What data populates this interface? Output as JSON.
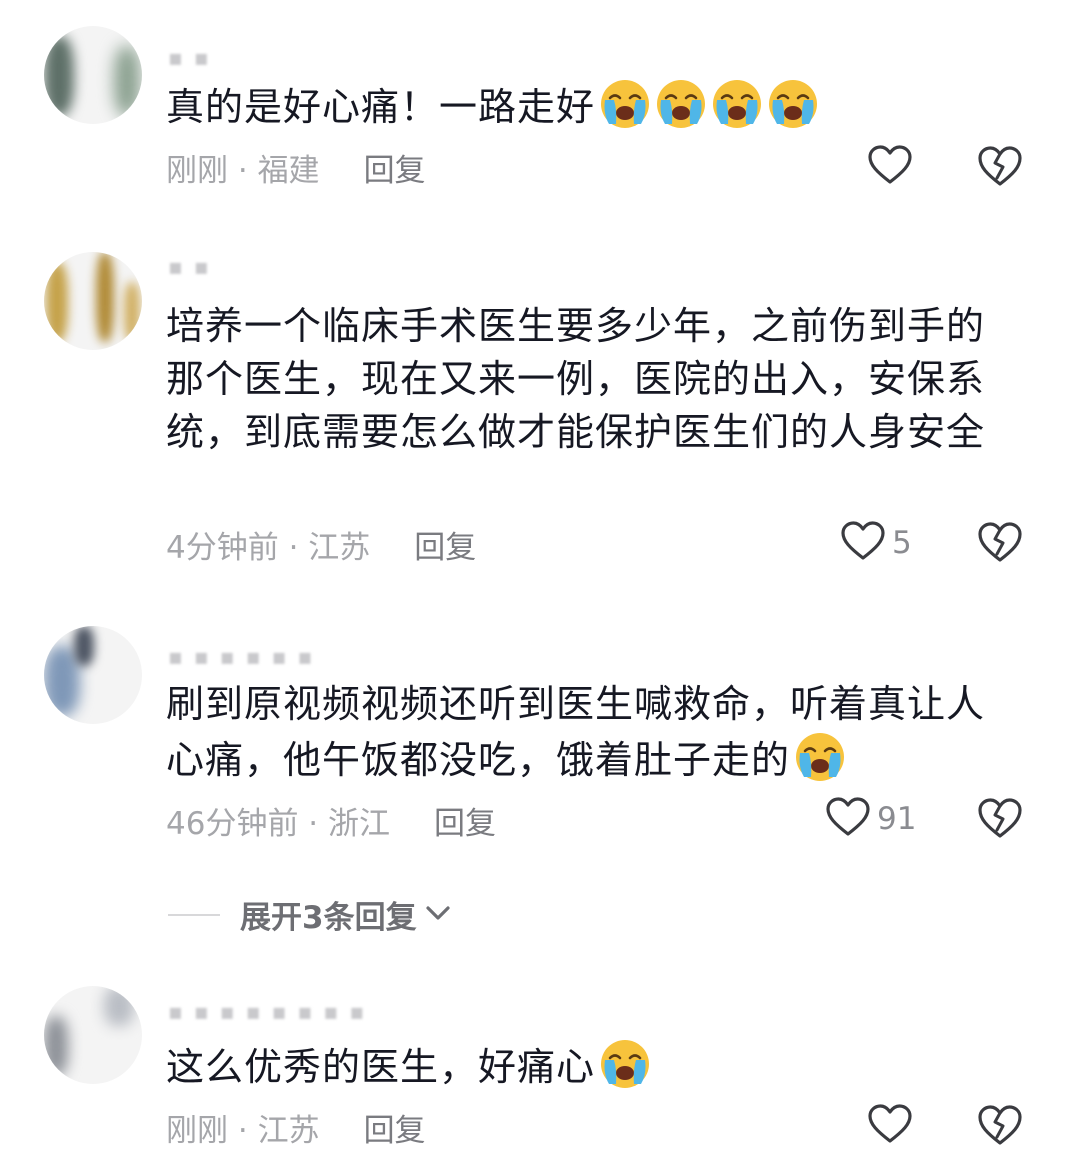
{
  "comments": [
    {
      "text": "真的是好心痛！一路走好",
      "emoji_count": 4,
      "time": "刚刚",
      "location": "福建",
      "reply_label": "回复",
      "like_count": ""
    },
    {
      "text": "培养一个临床手术医生要多少年，之前伤到手的那个医生，现在又来一例，医院的出入，安保系统，到底需要怎么做才能保护医生们的人身安全",
      "emoji_count": 0,
      "time": "4分钟前",
      "location": "江苏",
      "reply_label": "回复",
      "like_count": "5"
    },
    {
      "text": "刷到原视频视频还听到医生喊救命，听着真让人心痛，他午饭都没吃，饿着肚子走的",
      "emoji_count": 1,
      "time": "46分钟前",
      "location": "浙江",
      "reply_label": "回复",
      "like_count": "91"
    },
    {
      "text": "这么优秀的医生，好痛心",
      "emoji_count": 1,
      "time": "刚刚",
      "location": "江苏",
      "reply_label": "回复",
      "like_count": ""
    }
  ],
  "expand_replies": "展开3条回复",
  "separator": " · ",
  "icons": {
    "like": "heart-outline-icon",
    "dislike": "broken-heart-icon",
    "emoji": "loudly-crying-face-emoji",
    "expand": "chevron-down-icon"
  },
  "colors": {
    "text": "#161823",
    "meta": "#a5a6aa",
    "emoji_face": "#f7c33c",
    "emoji_tears": "#4fb6e8"
  }
}
